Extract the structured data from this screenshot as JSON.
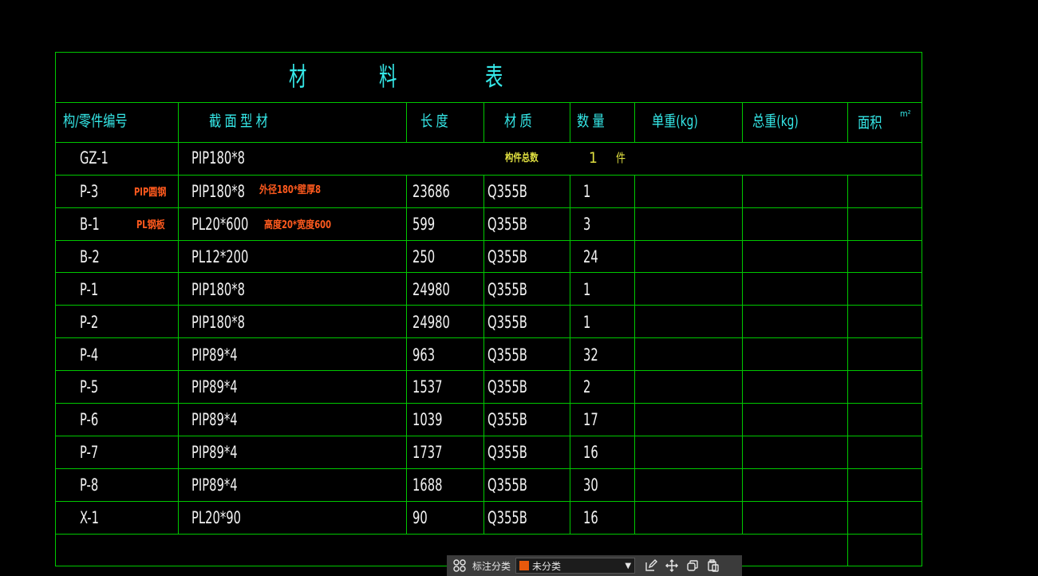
{
  "table": {
    "title_chars": [
      "材",
      "料",
      "表"
    ],
    "headers": {
      "part_no": "构/零件编号",
      "section": "截 面 型 材",
      "length": "长 度",
      "material": "材 质",
      "quantity": "数 量",
      "unit_weight": "单重(kg)",
      "total_weight": "总重(kg)",
      "area": "面积",
      "area_unit": "m²"
    },
    "summary": {
      "part_no": "GZ-1",
      "section": "PIP180*8",
      "label": "构件总数",
      "count": "1",
      "unit": "件"
    },
    "rows": [
      {
        "part_no": "P-3",
        "section": "PIP180*8",
        "length": "23686",
        "material": "Q355B",
        "quantity": "1"
      },
      {
        "part_no": "B-1",
        "section": "PL20*600",
        "length": "599",
        "material": "Q355B",
        "quantity": "3"
      },
      {
        "part_no": "B-2",
        "section": "PL12*200",
        "length": "250",
        "material": "Q355B",
        "quantity": "24"
      },
      {
        "part_no": "P-1",
        "section": "PIP180*8",
        "length": "24980",
        "material": "Q355B",
        "quantity": "1"
      },
      {
        "part_no": "P-2",
        "section": "PIP180*8",
        "length": "24980",
        "material": "Q355B",
        "quantity": "1"
      },
      {
        "part_no": "P-4",
        "section": "PIP89*4",
        "length": "963",
        "material": "Q355B",
        "quantity": "32"
      },
      {
        "part_no": "P-5",
        "section": "PIP89*4",
        "length": "1537",
        "material": "Q355B",
        "quantity": "2"
      },
      {
        "part_no": "P-6",
        "section": "PIP89*4",
        "length": "1039",
        "material": "Q355B",
        "quantity": "17"
      },
      {
        "part_no": "P-7",
        "section": "PIP89*4",
        "length": "1737",
        "material": "Q355B",
        "quantity": "16"
      },
      {
        "part_no": "P-8",
        "section": "PIP89*4",
        "length": "1688",
        "material": "Q355B",
        "quantity": "30"
      },
      {
        "part_no": "X-1",
        "section": "PL20*90",
        "length": "90",
        "material": "Q355B",
        "quantity": "16"
      }
    ],
    "annotations": {
      "p3_type": "PIP圆钢",
      "p3_desc": "外径180*壁厚8",
      "b1_type": "PL钢板",
      "b1_desc": "高度20*宽度600"
    }
  },
  "toolbar": {
    "grid_icon": "grid-icon",
    "label": "标注分类",
    "selected_category": "未分类",
    "swatch_color": "#e8590c",
    "icons": [
      "edit-icon",
      "move-icon",
      "copy-icon",
      "paste-icon"
    ]
  },
  "colors": {
    "background": "#000000",
    "grid_line": "#00c800",
    "text_white": "#f2f2f2",
    "text_cyan": "#35e8e8",
    "annotation_orange": "#ff5a1e",
    "summary_yellow": "#e0e040"
  }
}
